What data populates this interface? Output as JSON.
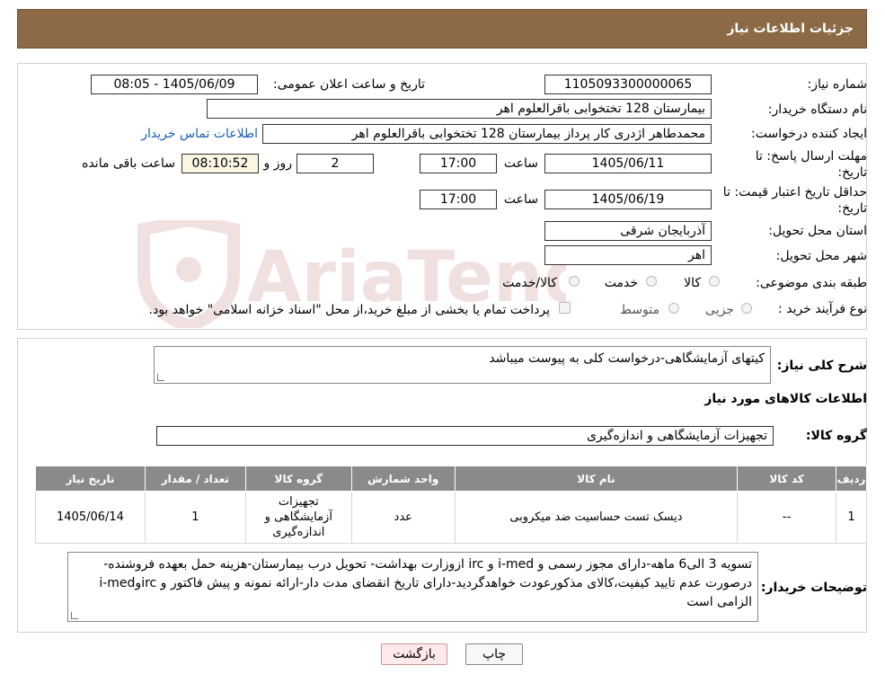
{
  "header": {
    "title": "جزئیات اطلاعات نیاز"
  },
  "form": {
    "need_number_label": "شماره نیاز:",
    "need_number": "1105093300000065",
    "announce_label": "تاریخ و ساعت اعلان عمومی:",
    "announce_value": "1405/06/09 - 08:05",
    "buyer_org_label": "نام دستگاه خریدار:",
    "buyer_org": "بیمارستان 128 تختخوابی باقرالعلوم اهر",
    "creator_label": "ایجاد کننده درخواست:",
    "creator": "محمدطاهر اژدری کار پرداز بیمارستان 128 تختخوابی باقرالعلوم اهر",
    "contact_link": "اطلاعات تماس خریدار",
    "deadline_label_1": "مهلت ارسال پاسخ: تا",
    "deadline_label_2": "تاریخ:",
    "deadline_date": "1405/06/11",
    "time_label": "ساعت",
    "deadline_time": "17:00",
    "days_value": "2",
    "days_label": "روز و",
    "remaining_time": "08:10:52",
    "remaining_label": "ساعت باقی مانده",
    "validity_label_1": "حداقل تاریخ اعتبار قیمت: تا",
    "validity_label_2": "تاریخ:",
    "validity_date": "1405/06/19",
    "validity_time": "17:00",
    "province_label": "استان محل تحویل:",
    "province": "آذربایجان شرقی",
    "city_label": "شهر محل تحویل:",
    "city": "اهر",
    "category_label": "طبقه بندی موضوعی:",
    "category_options": [
      "کالا",
      "خدمت",
      "کالا/خدمت"
    ],
    "process_label": "نوع فرآیند خرید :",
    "process_options": [
      "جزیی",
      "متوسط"
    ],
    "payment_note": "پرداخت تمام یا بخشی از مبلغ خرید،از محل \"اسناد خزانه اسلامی\" خواهد بود."
  },
  "details": {
    "summary_label": "شرح کلی نیاز:",
    "summary": "کیتهای آزمایشگاهی-درخواست کلی به پیوست میباشد",
    "goods_info_title": "اطلاعات کالاهای مورد نیاز",
    "goods_group_label": "گروه کالا:",
    "goods_group": "تجهیزات آزمایشگاهی و اندازه‌گیری",
    "table": {
      "headers": [
        "ردیف",
        "کد کالا",
        "نام کالا",
        "واحد شمارش",
        "گروه کالا",
        "تعداد / مقدار",
        "تاریخ نیاز"
      ],
      "rows": [
        {
          "row": "1",
          "code": "--",
          "name": "دیسک تست حساسیت ضد میکروبی",
          "unit": "عدد",
          "group": "تجهیزات آزمایشگاهی و اندازه‌گیری",
          "qty": "1",
          "date": "1405/06/14"
        }
      ]
    },
    "buyer_notes_label": "توضیحات خریدار:",
    "buyer_notes": "تسویه 3 الی6 ماهه-دارای مجوز رسمی و i-med و irc ازوزارت بهداشت- تحویل درب بیمارستان-هزینه حمل بعهده فروشنده-درصورت عدم تایید کیفیت،کالای مذکورعودت خواهدگردید-دارای تاریخ انقضای مدت دار-ارائه نمونه و پیش فاکتور و ircوi-med الزامی است"
  },
  "buttons": {
    "print": "چاپ",
    "back": "بازگشت"
  },
  "watermark": {
    "text": "AriaTender.neT"
  },
  "colors": {
    "header_bg": "#8b6a45",
    "link": "#1a5fb4",
    "back_bg": "#fde8ea",
    "table_head": "#8a8a8a"
  }
}
